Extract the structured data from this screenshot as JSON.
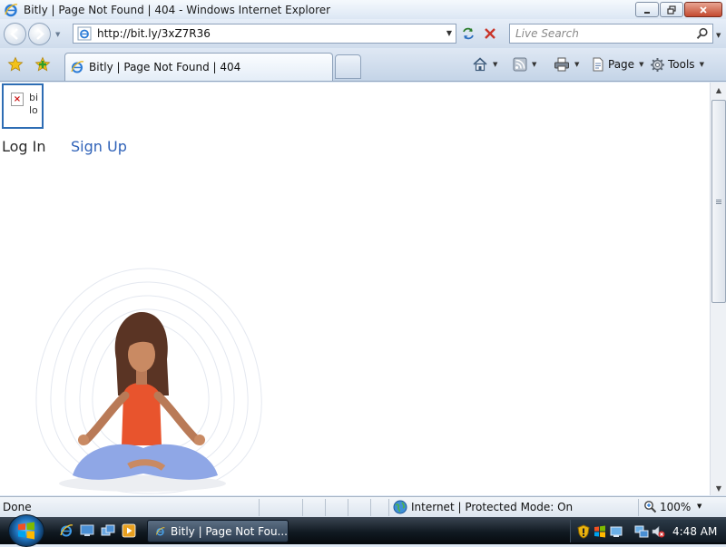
{
  "window": {
    "title": "Bitly | Page Not Found | 404 - Windows Internet Explorer"
  },
  "toolbar": {
    "url": "http://bit.ly/3xZ7R36",
    "search_placeholder": "Live Search"
  },
  "tabs": [
    {
      "label": "Bitly | Page Not Found | 404",
      "active": true
    }
  ],
  "commands": {
    "page_label": "Page",
    "tools_label": "Tools"
  },
  "page": {
    "logo_alt_text": "bi lo",
    "login_label": "Log In",
    "signup_label": "Sign Up",
    "link_color": "#2f62b8"
  },
  "statusbar": {
    "status": "Done",
    "zone": "Internet | Protected Mode: On",
    "zoom": "100%"
  },
  "taskbar": {
    "window_button_label": "Bitly | Page Not Fou...",
    "clock": "4:48 AM"
  },
  "icons": [
    "ie-logo",
    "back-arrow",
    "forward-arrow",
    "refresh",
    "stop",
    "search",
    "favorites-star",
    "add-favorites",
    "home",
    "feeds",
    "print",
    "page",
    "tools-gear",
    "globe",
    "zoom-magnifier",
    "windows-orb",
    "shield",
    "speaker-muted",
    "network"
  ]
}
